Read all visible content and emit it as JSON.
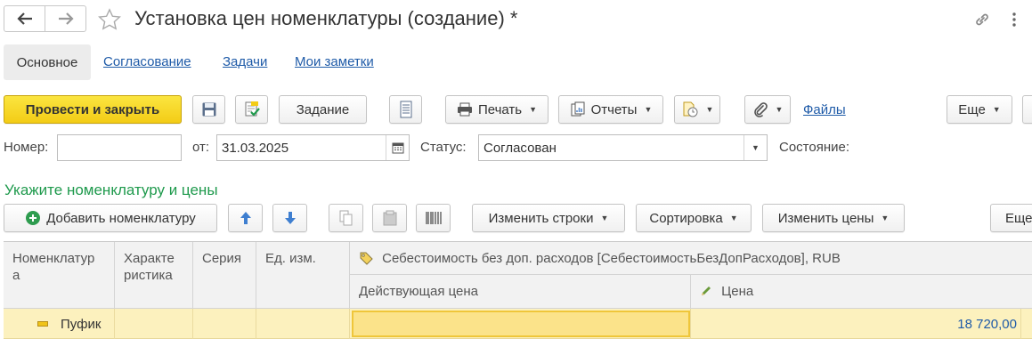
{
  "header": {
    "back_icon": "arrow-left-icon",
    "forward_icon": "arrow-right-icon",
    "favorite_icon": "star-icon",
    "title": "Установка цен номенклатуры (создание) *",
    "link_icon": "link-icon",
    "more_icon": "vertical-dots-icon"
  },
  "tabs": {
    "main": "Основное",
    "approval": "Согласование",
    "tasks": "Задачи",
    "notes": "Мои заметки"
  },
  "toolbar": {
    "post_close": "Провести и закрыть",
    "task": "Задание",
    "print": "Печать",
    "reports": "Отчеты",
    "files": "Файлы",
    "more": "Еще"
  },
  "form": {
    "number_label": "Номер:",
    "number_value": "",
    "date_label": "от:",
    "date_value": "31.03.2025",
    "status_label": "Статус:",
    "status_value": "Согласован",
    "state_label": "Состояние:"
  },
  "section": {
    "title": "Укажите номенклатуру и цены"
  },
  "table_toolbar": {
    "add": "Добавить номенклатуру",
    "change_rows": "Изменить строки",
    "sort": "Сортировка",
    "change_prices": "Изменить цены",
    "more": "Еще"
  },
  "table": {
    "col_nomenclature_1": "Номенклатур",
    "col_nomenclature_2": "а",
    "col_characteristic_1": "Характе",
    "col_characteristic_2": "ристика",
    "col_series": "Серия",
    "col_unit": "Ед. изм.",
    "col_group": "Себестоимость без доп. расходов [СебестоимостьБезДопРасходов], RUB",
    "col_current_price": "Действующая цена",
    "col_price": "Цена",
    "rows": [
      {
        "name": "Пуфик",
        "characteristic": "",
        "series": "",
        "unit": "",
        "current_price": "",
        "price": "18 720,00"
      }
    ]
  },
  "colors": {
    "primary_button": "#f6d21c",
    "section_title": "#1f9a4d",
    "link": "#1f5ba8",
    "selected_row": "#fcf1be",
    "active_cell": "#fbe38a"
  }
}
